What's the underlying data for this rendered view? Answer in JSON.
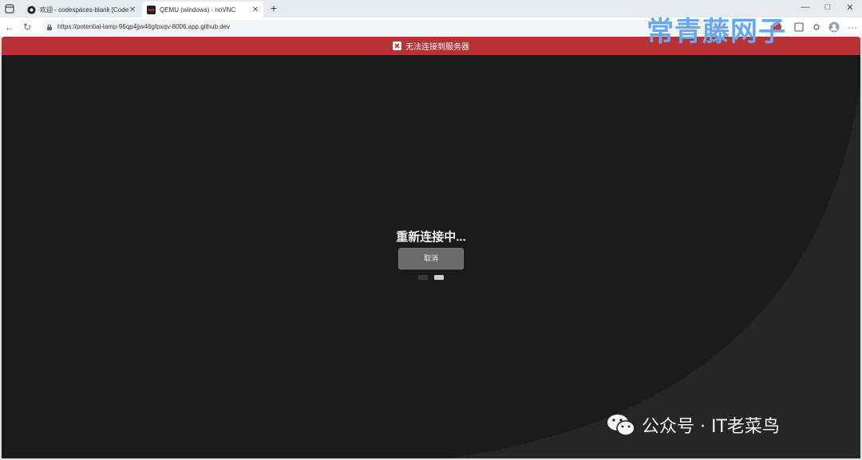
{
  "browser": {
    "tabs": [
      {
        "title": "欢迎 - codespaces-blank [Codespaces]",
        "favicon": "github-icon",
        "active": false
      },
      {
        "title": "QEMU (windows) - noVNC",
        "favicon": "novnc-icon",
        "active": true
      }
    ],
    "new_tab_label": "+",
    "window_controls": {
      "minimize": "—",
      "maximize": "□",
      "close": "✕"
    },
    "address": "https://potential-lamp-96qp4jjw46gfpxqv-8006.app.github.dev",
    "icons": [
      "back-icon",
      "refresh-icon",
      "lock-icon",
      "extension-icon",
      "profile-icon",
      "more-icon"
    ]
  },
  "novnc": {
    "error_message": "无法连接到服务器",
    "status_text": "重新连接中...",
    "cancel_label": "取消",
    "error_color": "#b73235",
    "background_color": "#1b1b1c"
  },
  "watermarks": {
    "top": "常青藤网子",
    "bottom": "公众号 · IT老菜鸟"
  }
}
